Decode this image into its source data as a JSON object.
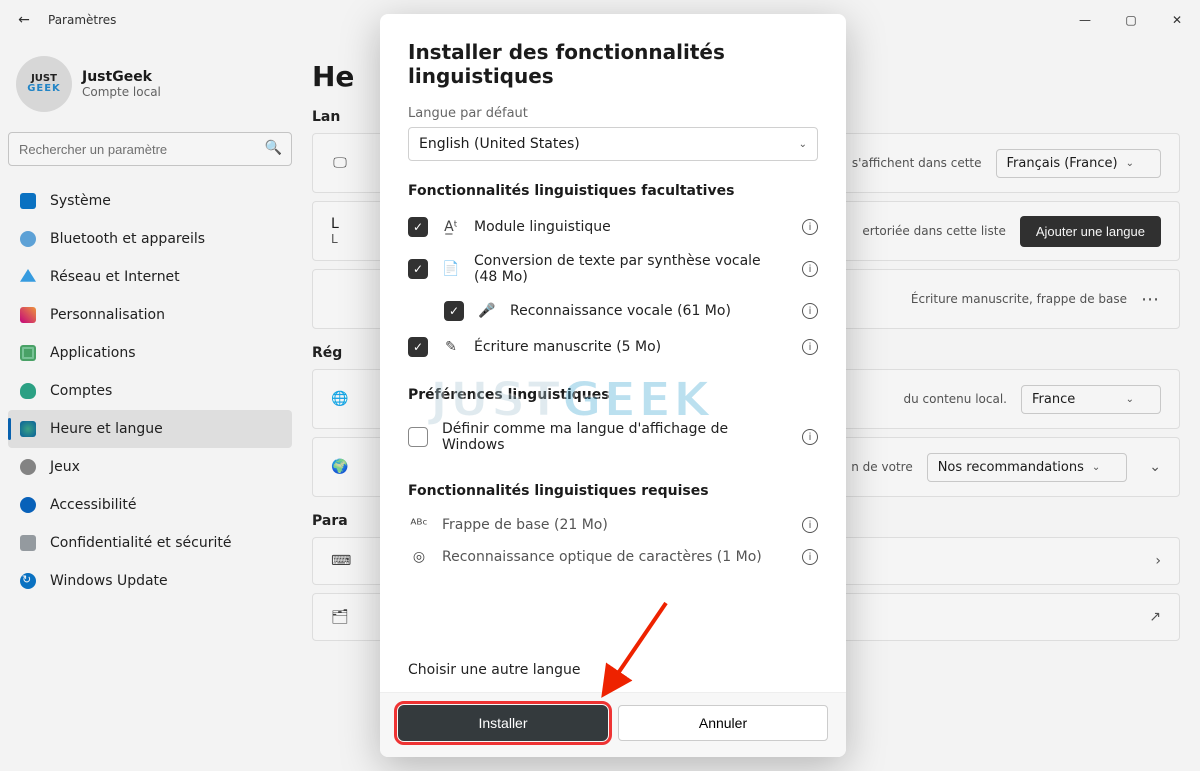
{
  "titlebar": {
    "title": "Paramètres"
  },
  "profile": {
    "name": "JustGeek",
    "subtitle": "Compte local",
    "logo_top": "JUST",
    "logo_bottom": "GEEK"
  },
  "search": {
    "placeholder": "Rechercher un paramètre"
  },
  "sidebar": {
    "items": [
      {
        "label": "Système"
      },
      {
        "label": "Bluetooth et appareils"
      },
      {
        "label": "Réseau et Internet"
      },
      {
        "label": "Personnalisation"
      },
      {
        "label": "Applications"
      },
      {
        "label": "Comptes"
      },
      {
        "label": "Heure et langue"
      },
      {
        "label": "Jeux"
      },
      {
        "label": "Accessibilité"
      },
      {
        "label": "Confidentialité et sécurité"
      },
      {
        "label": "Windows Update"
      }
    ],
    "active_index": 6
  },
  "main": {
    "page_title_fragment": "He",
    "section_lang": "Lan",
    "card1_right_text": "s'affichent dans cette",
    "card1_select": "Français (France)",
    "card2_line1": "L",
    "card2_line2": "L",
    "card2_right_text": "ertoriée dans cette liste",
    "card2_button": "Ajouter une langue",
    "card3_right_text": "Écriture manuscrite, frappe de base",
    "section_region": "Rég",
    "card4_right_text": "du contenu local.",
    "card4_select": "France",
    "card5_right_text": "n de votre",
    "card5_select": "Nos recommandations",
    "section_params": "Para"
  },
  "modal": {
    "title": "Installer des fonctionnalités linguistiques",
    "lang_default_label": "Langue par défaut",
    "lang_default_value": "English (United States)",
    "section_optional": "Fonctionnalités linguistiques facultatives",
    "opt1": "Module linguistique",
    "opt2": "Conversion de texte par synthèse vocale (48 Mo)",
    "opt3": "Reconnaissance vocale (61 Mo)",
    "opt4": "Écriture manuscrite (5 Mo)",
    "section_prefs": "Préférences linguistiques",
    "pref1": "Définir comme ma langue d'affichage de Windows",
    "section_required": "Fonctionnalités linguistiques requises",
    "req1": "Frappe de base (21 Mo)",
    "req2": "Reconnaissance optique de caractères (1 Mo)",
    "choose_other": "Choisir une autre langue",
    "install_btn": "Installer",
    "cancel_btn": "Annuler"
  },
  "watermark": {
    "a": "JUST",
    "b": "GEEK"
  }
}
